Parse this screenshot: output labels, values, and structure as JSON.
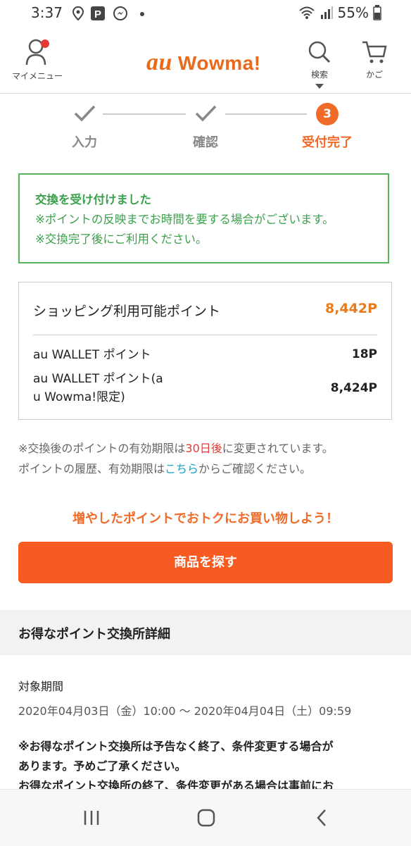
{
  "status_bar": {
    "time": "3:37",
    "battery": "55%",
    "icons": [
      "location-icon",
      "parking-icon",
      "messenger-icon",
      "dot-icon",
      "wifi-icon",
      "signal-icon",
      "battery-icon"
    ]
  },
  "header": {
    "my_menu_label": "マイメニュー",
    "logo_au": "au",
    "logo_text": "Wowma!",
    "search_label": "検索",
    "cart_label": "かご"
  },
  "steps": [
    {
      "label": "入力",
      "state": "done"
    },
    {
      "label": "確認",
      "state": "done"
    },
    {
      "label": "受付完了",
      "state": "active",
      "number": "3"
    }
  ],
  "notice": {
    "title": "交換を受け付けました",
    "line1": "※ポイントの反映までお時間を要する場合がございます。",
    "line2": "※交換完了後にご利用ください。"
  },
  "points": {
    "main_label": "ショッピング利用可能ポイント",
    "main_value": "8,442P",
    "row1_label": "au WALLET ポイント",
    "row1_value": "18P",
    "row2_label_line1": "au WALLET ポイント(a",
    "row2_label_line2": "u Wowma!限定)",
    "row2_value": "8,424P"
  },
  "note": {
    "part1": "※交換後のポイントの有効期限は",
    "highlight": "30日後",
    "part2": "に変更されています。",
    "line2_part1": "ポイントの履歴、有効期限は",
    "link": "こちら",
    "line2_part2": "からご確認ください。"
  },
  "promo": {
    "text": "増やしたポイントでおトクにお買い物しよう！",
    "button_label": "商品を探す"
  },
  "details": {
    "section_title": "お得なポイント交換所詳細",
    "period_label": "対象期間",
    "period_value": "2020年04月03日（金）10:00 ～ 2020年04月04日（土）09:59",
    "notice_line1": "※お得なポイント交換所は予告なく終了、条件変更する場合が",
    "notice_line2": "あります。予めご了承ください。",
    "notice_line3": "お得なポイント交換所の終了、条件変更がある場合は事前にお"
  },
  "colors": {
    "accent": "#f06a28",
    "button": "#f75b22",
    "success": "#3ca14d",
    "success_border": "#58b35a",
    "points_value": "#ea7b1a",
    "highlight_red": "#e53935",
    "link": "#1aa3c3"
  },
  "nav_bar": {
    "icons": [
      "recent-apps-icon",
      "home-icon",
      "back-icon"
    ]
  }
}
